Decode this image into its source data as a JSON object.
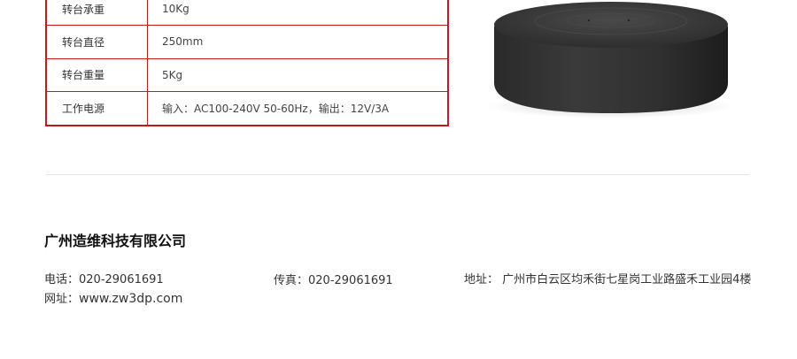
{
  "specs": [
    {
      "label": "转台承重",
      "value": "10Kg"
    },
    {
      "label": "转台直径",
      "value": "250mm"
    },
    {
      "label": "转台重量",
      "value": "5Kg"
    },
    {
      "label": "工作电源",
      "value": "输入：AC100-240V 50-60Hz，输出：12V/3A"
    }
  ],
  "footer": {
    "company_name": "广州造维科技有限公司",
    "phone_label": "电话：",
    "phone": "020-29061691",
    "fax_label": "传真：",
    "fax": "020-29061691",
    "address_label": "地址：",
    "address": "广州市白云区均禾街七星岗工业路盛禾工业园4楼",
    "website_label": "网址：",
    "website": "www.zw3dp.com"
  },
  "colors": {
    "table_border": "#c8161d",
    "divider": "#e3e3e3"
  },
  "icons": {
    "product": "turntable-image"
  }
}
